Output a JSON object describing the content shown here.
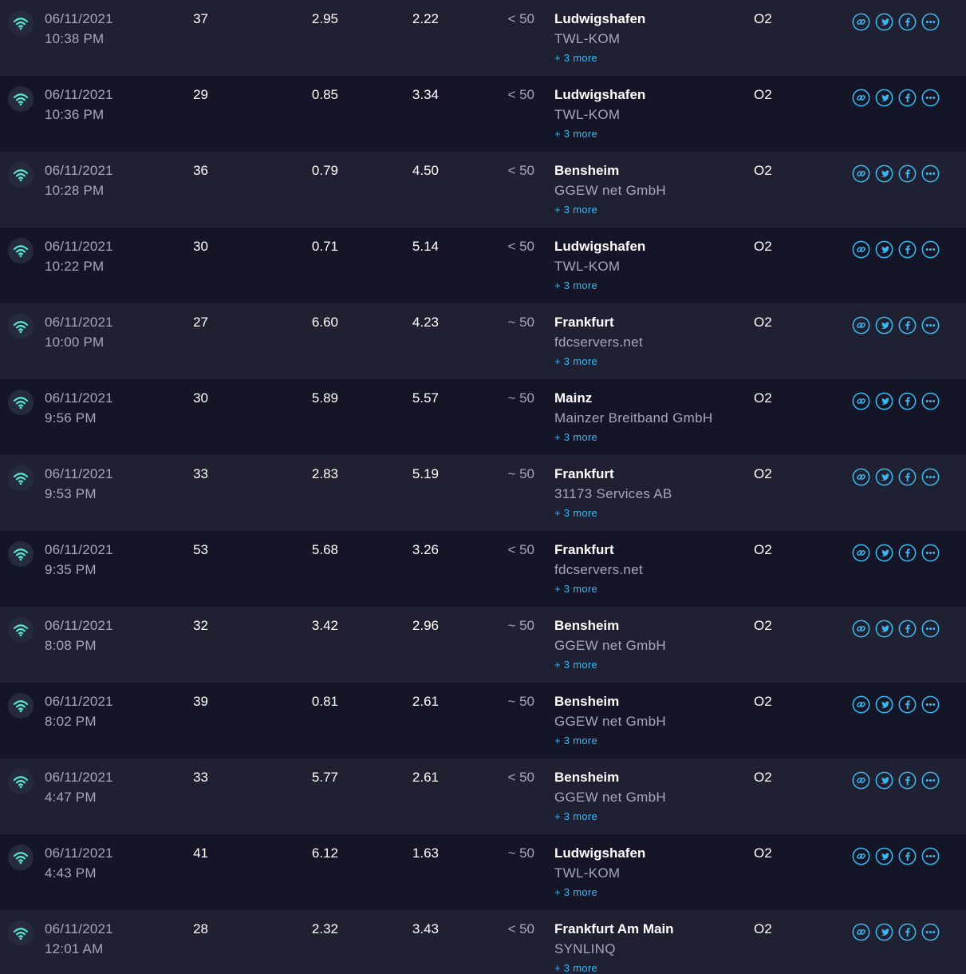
{
  "colors": {
    "row_odd": "#1f2133",
    "row_even": "#141526",
    "accent": "#3bb8f0",
    "wifi_icon": "#58e5d4",
    "primary_text": "#ffffff",
    "secondary_text": "#a5a8b8"
  },
  "icons": {
    "connection": "wifi-icon",
    "share": [
      "link-icon",
      "twitter-icon",
      "facebook-icon",
      "more-options-icon"
    ]
  },
  "results": [
    {
      "date": "06/11/2021",
      "time": "10:38 PM",
      "ping": "37",
      "download": "2.95",
      "upload": "2.22",
      "packet_loss": "< 50",
      "server_city": "Ludwigshafen",
      "server_isp": "TWL-KOM",
      "more_label": "+ 3 more",
      "provider": "O2"
    },
    {
      "date": "06/11/2021",
      "time": "10:36 PM",
      "ping": "29",
      "download": "0.85",
      "upload": "3.34",
      "packet_loss": "< 50",
      "server_city": "Ludwigshafen",
      "server_isp": "TWL-KOM",
      "more_label": "+ 3 more",
      "provider": "O2"
    },
    {
      "date": "06/11/2021",
      "time": "10:28 PM",
      "ping": "36",
      "download": "0.79",
      "upload": "4.50",
      "packet_loss": "< 50",
      "server_city": "Bensheim",
      "server_isp": "GGEW net GmbH",
      "more_label": "+ 3 more",
      "provider": "O2"
    },
    {
      "date": "06/11/2021",
      "time": "10:22 PM",
      "ping": "30",
      "download": "0.71",
      "upload": "5.14",
      "packet_loss": "< 50",
      "server_city": "Ludwigshafen",
      "server_isp": "TWL-KOM",
      "more_label": "+ 3 more",
      "provider": "O2"
    },
    {
      "date": "06/11/2021",
      "time": "10:00 PM",
      "ping": "27",
      "download": "6.60",
      "upload": "4.23",
      "packet_loss": "~ 50",
      "server_city": "Frankfurt",
      "server_isp": "fdcservers.net",
      "more_label": "+ 3 more",
      "provider": "O2"
    },
    {
      "date": "06/11/2021",
      "time": "9:56 PM",
      "ping": "30",
      "download": "5.89",
      "upload": "5.57",
      "packet_loss": "~ 50",
      "server_city": "Mainz",
      "server_isp": "Mainzer Breitband GmbH",
      "more_label": "+ 3 more",
      "provider": "O2"
    },
    {
      "date": "06/11/2021",
      "time": "9:53 PM",
      "ping": "33",
      "download": "2.83",
      "upload": "5.19",
      "packet_loss": "~ 50",
      "server_city": "Frankfurt",
      "server_isp": "31173 Services AB",
      "more_label": "+ 3 more",
      "provider": "O2"
    },
    {
      "date": "06/11/2021",
      "time": "9:35 PM",
      "ping": "53",
      "download": "5.68",
      "upload": "3.26",
      "packet_loss": "< 50",
      "server_city": "Frankfurt",
      "server_isp": "fdcservers.net",
      "more_label": "+ 3 more",
      "provider": "O2"
    },
    {
      "date": "06/11/2021",
      "time": "8:08 PM",
      "ping": "32",
      "download": "3.42",
      "upload": "2.96",
      "packet_loss": "~ 50",
      "server_city": "Bensheim",
      "server_isp": "GGEW net GmbH",
      "more_label": "+ 3 more",
      "provider": "O2"
    },
    {
      "date": "06/11/2021",
      "time": "8:02 PM",
      "ping": "39",
      "download": "0.81",
      "upload": "2.61",
      "packet_loss": "~ 50",
      "server_city": "Bensheim",
      "server_isp": "GGEW net GmbH",
      "more_label": "+ 3 more",
      "provider": "O2"
    },
    {
      "date": "06/11/2021",
      "time": "4:47 PM",
      "ping": "33",
      "download": "5.77",
      "upload": "2.61",
      "packet_loss": "< 50",
      "server_city": "Bensheim",
      "server_isp": "GGEW net GmbH",
      "more_label": "+ 3 more",
      "provider": "O2"
    },
    {
      "date": "06/11/2021",
      "time": "4:43 PM",
      "ping": "41",
      "download": "6.12",
      "upload": "1.63",
      "packet_loss": "~ 50",
      "server_city": "Ludwigshafen",
      "server_isp": "TWL-KOM",
      "more_label": "+ 3 more",
      "provider": "O2"
    },
    {
      "date": "06/11/2021",
      "time": "12:01 AM",
      "ping": "28",
      "download": "2.32",
      "upload": "3.43",
      "packet_loss": "< 50",
      "server_city": "Frankfurt Am Main",
      "server_isp": "SYNLINQ",
      "more_label": "+ 3 more",
      "provider": "O2"
    }
  ]
}
